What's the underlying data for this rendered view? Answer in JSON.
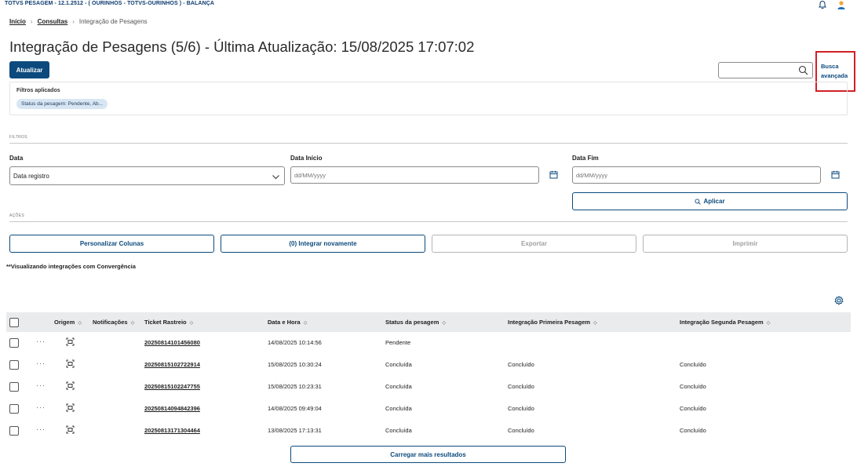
{
  "app": {
    "title": "TOTVS PESAGEM - 12.1.2512 - ( OURINHOS - TOTVS-OURINHOS ) - BALANÇA"
  },
  "breadcrumb": {
    "items": [
      "Início",
      "Consultas",
      "Integração de Pesagens"
    ]
  },
  "page": {
    "title": "Integração de Pesagens (5/6) - Última Atualização: 15/08/2025 17:07:02",
    "refresh_label": "Atualizar"
  },
  "search": {
    "value": "",
    "placeholder": "",
    "advanced_label": "Busca avançada"
  },
  "applied_filters": {
    "label": "Filtros aplicados",
    "chip": "Status da pesagem: Pendente, Ab..."
  },
  "filters": {
    "section_title": "FILTROS",
    "date_label": "Data",
    "date_value": "Data registro",
    "start_label": "Data Início",
    "start_placeholder": "dd/MM/yyyy",
    "end_label": "Data Fim",
    "end_placeholder": "dd/MM/yyyy",
    "apply_label": "Aplicar"
  },
  "actions": {
    "section_title": "AÇÕES",
    "customize_label": "Personalizar Colunas",
    "reintegrate_label": "(0) Integrar novamente",
    "export_label": "Exportar",
    "print_label": "Imprimir"
  },
  "note": "**Visualizando integrações com Convergência",
  "table": {
    "columns": {
      "origin": "Origem",
      "notifications": "Notificações",
      "ticket": "Ticket Rastreio",
      "datetime": "Data e Hora",
      "status": "Status da pesagem",
      "first": "Integração Primeira Pesagem",
      "second": "Integração Segunda Pesagem"
    },
    "rows": [
      {
        "ticket": "20250814101456080",
        "datetime": "14/08/2025 10:14:56",
        "status": "Pendente",
        "first": "",
        "second": ""
      },
      {
        "ticket": "20250815102722914",
        "datetime": "15/08/2025 10:30:24",
        "status": "Concluída",
        "first": "Concluído",
        "second": "Concluído"
      },
      {
        "ticket": "20250815102247755",
        "datetime": "15/08/2025 10:23:31",
        "status": "Concluída",
        "first": "Concluído",
        "second": "Concluído"
      },
      {
        "ticket": "20250814094842396",
        "datetime": "14/08/2025 09:49:04",
        "status": "Concluída",
        "first": "Concluído",
        "second": "Concluído"
      },
      {
        "ticket": "20250813171304464",
        "datetime": "13/08/2025 17:13:31",
        "status": "Concluída",
        "first": "Concluído",
        "second": "Concluído"
      }
    ],
    "load_more_label": "Carregar mais resultados"
  },
  "colors": {
    "primary": "#0c4a7d",
    "highlight": "#d21f26",
    "header_bg": "#e9ebed"
  }
}
